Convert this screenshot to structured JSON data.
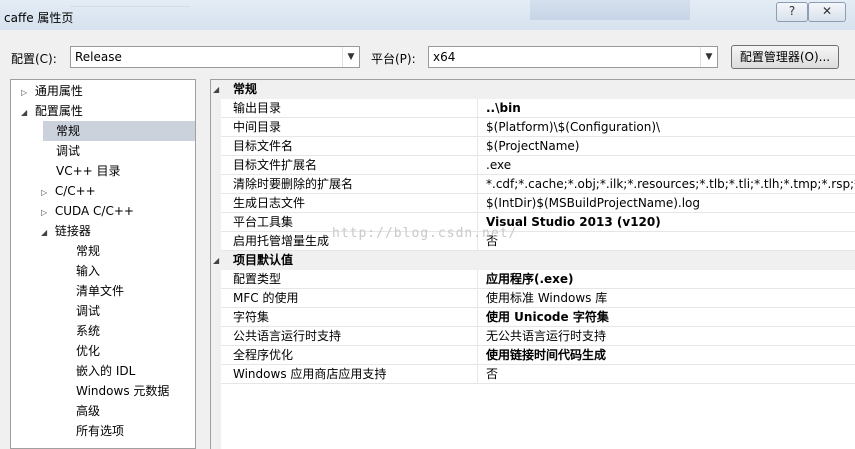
{
  "window": {
    "title": "caffe 属性页",
    "help_label": "?",
    "close_label": "✕"
  },
  "config": {
    "config_label": "配置(C):",
    "config_value": "Release",
    "platform_label": "平台(P):",
    "platform_value": "x64",
    "manager_button": "配置管理器(O)..."
  },
  "tree": {
    "items": [
      {
        "label": "通用属性",
        "twisty": "▷"
      },
      {
        "label": "配置属性",
        "twisty": "◢"
      },
      {
        "label": "常规",
        "twisty": ""
      },
      {
        "label": "调试",
        "twisty": ""
      },
      {
        "label": "VC++ 目录",
        "twisty": ""
      },
      {
        "label": "C/C++",
        "twisty": "▷"
      },
      {
        "label": "CUDA C/C++",
        "twisty": "▷"
      },
      {
        "label": "链接器",
        "twisty": "◢"
      },
      {
        "label": "常规",
        "twisty": ""
      },
      {
        "label": "输入",
        "twisty": ""
      },
      {
        "label": "清单文件",
        "twisty": ""
      },
      {
        "label": "调试",
        "twisty": ""
      },
      {
        "label": "系统",
        "twisty": ""
      },
      {
        "label": "优化",
        "twisty": ""
      },
      {
        "label": "嵌入的 IDL",
        "twisty": ""
      },
      {
        "label": "Windows 元数据",
        "twisty": ""
      },
      {
        "label": "高级",
        "twisty": ""
      },
      {
        "label": "所有选项",
        "twisty": ""
      }
    ]
  },
  "grid": {
    "section_general": "常规",
    "general_rows": [
      {
        "name": "输出目录",
        "value": "..\\bin"
      },
      {
        "name": "中间目录",
        "value": "$(Platform)\\$(Configuration)\\"
      },
      {
        "name": "目标文件名",
        "value": "$(ProjectName)"
      },
      {
        "name": "目标文件扩展名",
        "value": ".exe"
      },
      {
        "name": "清除时要删除的扩展名",
        "value": "*.cdf;*.cache;*.obj;*.ilk;*.resources;*.tlb;*.tli;*.tlh;*.tmp;*.rsp;*.pgc;*.p"
      },
      {
        "name": "生成日志文件",
        "value": "$(IntDir)$(MSBuildProjectName).log"
      },
      {
        "name": "平台工具集",
        "value": "Visual Studio 2013 (v120)"
      },
      {
        "name": "启用托管增量生成",
        "value": "否"
      }
    ],
    "section_defaults": "项目默认值",
    "default_rows": [
      {
        "name": "配置类型",
        "value": "应用程序(.exe)"
      },
      {
        "name": "MFC 的使用",
        "value": "使用标准 Windows 库"
      },
      {
        "name": "字符集",
        "value": "使用 Unicode 字符集"
      },
      {
        "name": "公共语言运行时支持",
        "value": "无公共语言运行时支持"
      },
      {
        "name": "全程序优化",
        "value": "使用链接时间代码生成"
      },
      {
        "name": "Windows 应用商店应用支持",
        "value": "否"
      }
    ]
  },
  "watermark": "http://blog.csdn.net/"
}
